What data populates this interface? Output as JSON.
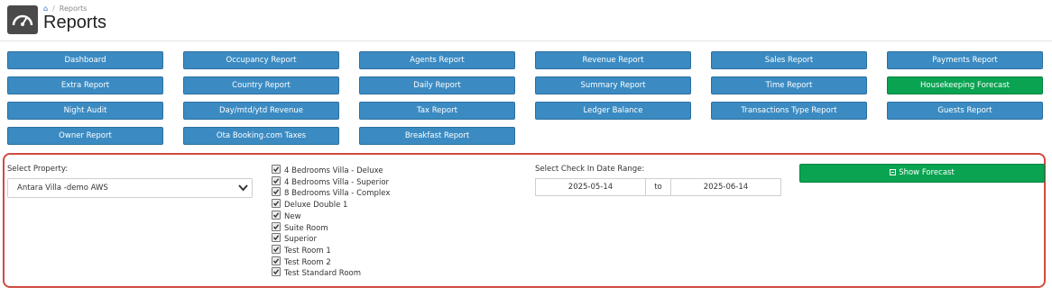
{
  "breadcrumb": {
    "current": "Reports"
  },
  "page": {
    "title": "Reports"
  },
  "report_buttons": [
    "Dashboard",
    "Occupancy Report",
    "Agents Report",
    "Revenue Report",
    "Sales Report",
    "Payments Report",
    "Extra Report",
    "Country Report",
    "Daily Report",
    "Summary Report",
    "Time Report",
    "Housekeeping Forecast",
    "Night Audit",
    "Day/mtd/ytd Revenue",
    "Tax Report",
    "Ledger Balance",
    "Transactions Type Report",
    "Guests Report",
    "Owner Report",
    "Ota Booking.com Taxes",
    "Breakfast Report"
  ],
  "active_report": "Housekeeping Forecast",
  "form": {
    "property_label": "Select Property:",
    "property_value": "Antara Villa -demo AWS",
    "rooms": [
      "4 Bedrooms Villa - Deluxe",
      "4 Bedrooms Villa - Superior",
      "8 Bedrooms Villa - Complex",
      "Deluxe Double 1",
      "New",
      "Suite Room",
      "Superior",
      "Test Room 1",
      "Test Room 2",
      "Test Standard Room"
    ],
    "date_range_label": "Select Check In Date Range:",
    "date_from": "2025-05-14",
    "date_to_label": "to",
    "date_to": "2025-06-14",
    "submit_label": "Show Forecast"
  },
  "colors": {
    "primary": "#3b8bc2",
    "success": "#0aa352",
    "highlight": "#d04b3f"
  }
}
